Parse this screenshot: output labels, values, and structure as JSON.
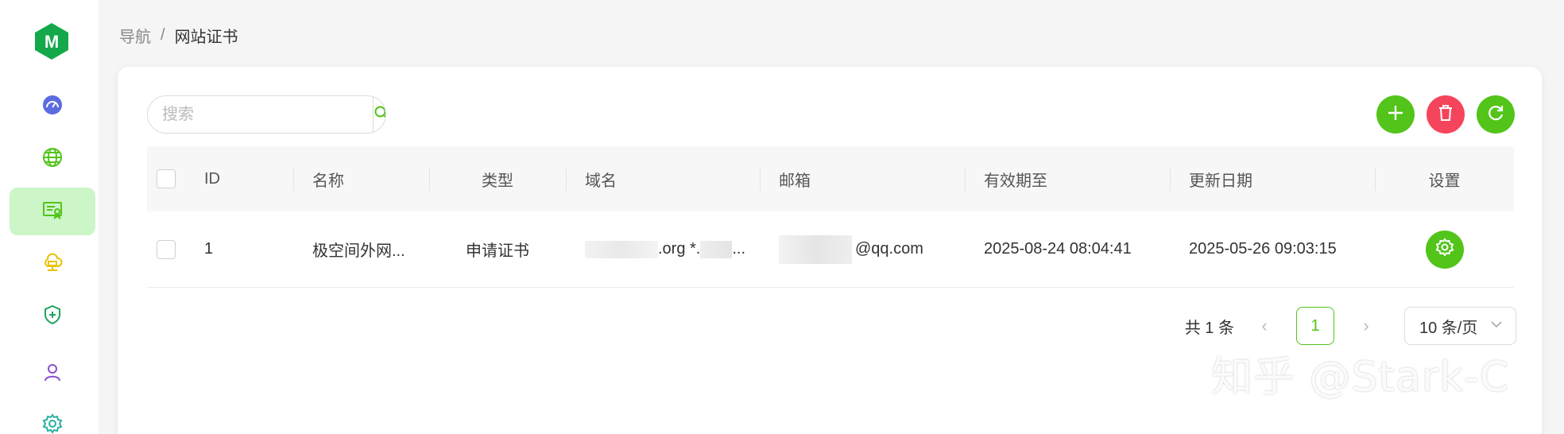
{
  "sidebar": {
    "logo_letter": "M",
    "items": [
      {
        "icon": "dashboard-icon",
        "color": "#5b6be0"
      },
      {
        "icon": "globe-icon",
        "color": "#52c41a"
      },
      {
        "icon": "certificate-icon",
        "color": "#52c41a",
        "active": true
      },
      {
        "icon": "cloud-network-icon",
        "color": "#e8c400"
      },
      {
        "icon": "shield-plus-icon",
        "color": "#1fa35c"
      },
      {
        "icon": "user-icon",
        "color": "#8a4fd1"
      },
      {
        "icon": "gear-icon",
        "color": "#2ab0a0"
      }
    ]
  },
  "breadcrumb": {
    "root": "导航",
    "separator": "/",
    "current": "网站证书"
  },
  "search": {
    "placeholder": "搜索",
    "value": ""
  },
  "table": {
    "headers": {
      "id": "ID",
      "name": "名称",
      "type": "类型",
      "domain": "域名",
      "email": "邮箱",
      "expires": "有效期至",
      "updated": "更新日期",
      "settings": "设置"
    },
    "rows": [
      {
        "id": "1",
        "name": "极空间外网...",
        "type": "申请证书",
        "domain_a": ".org *.",
        "domain_b": "...",
        "email": "@qq.com",
        "expires": "2025-08-24 08:04:41",
        "updated": "2025-05-26 09:03:15"
      }
    ]
  },
  "pagination": {
    "total": "共 1 条",
    "prev": "‹",
    "current": "1",
    "next": "›",
    "page_size": "10 条/页"
  },
  "watermark": "知乎 @Stark-C",
  "colors": {
    "accent": "#52c41a",
    "danger": "#f5455c",
    "logo": "#13a84a"
  }
}
